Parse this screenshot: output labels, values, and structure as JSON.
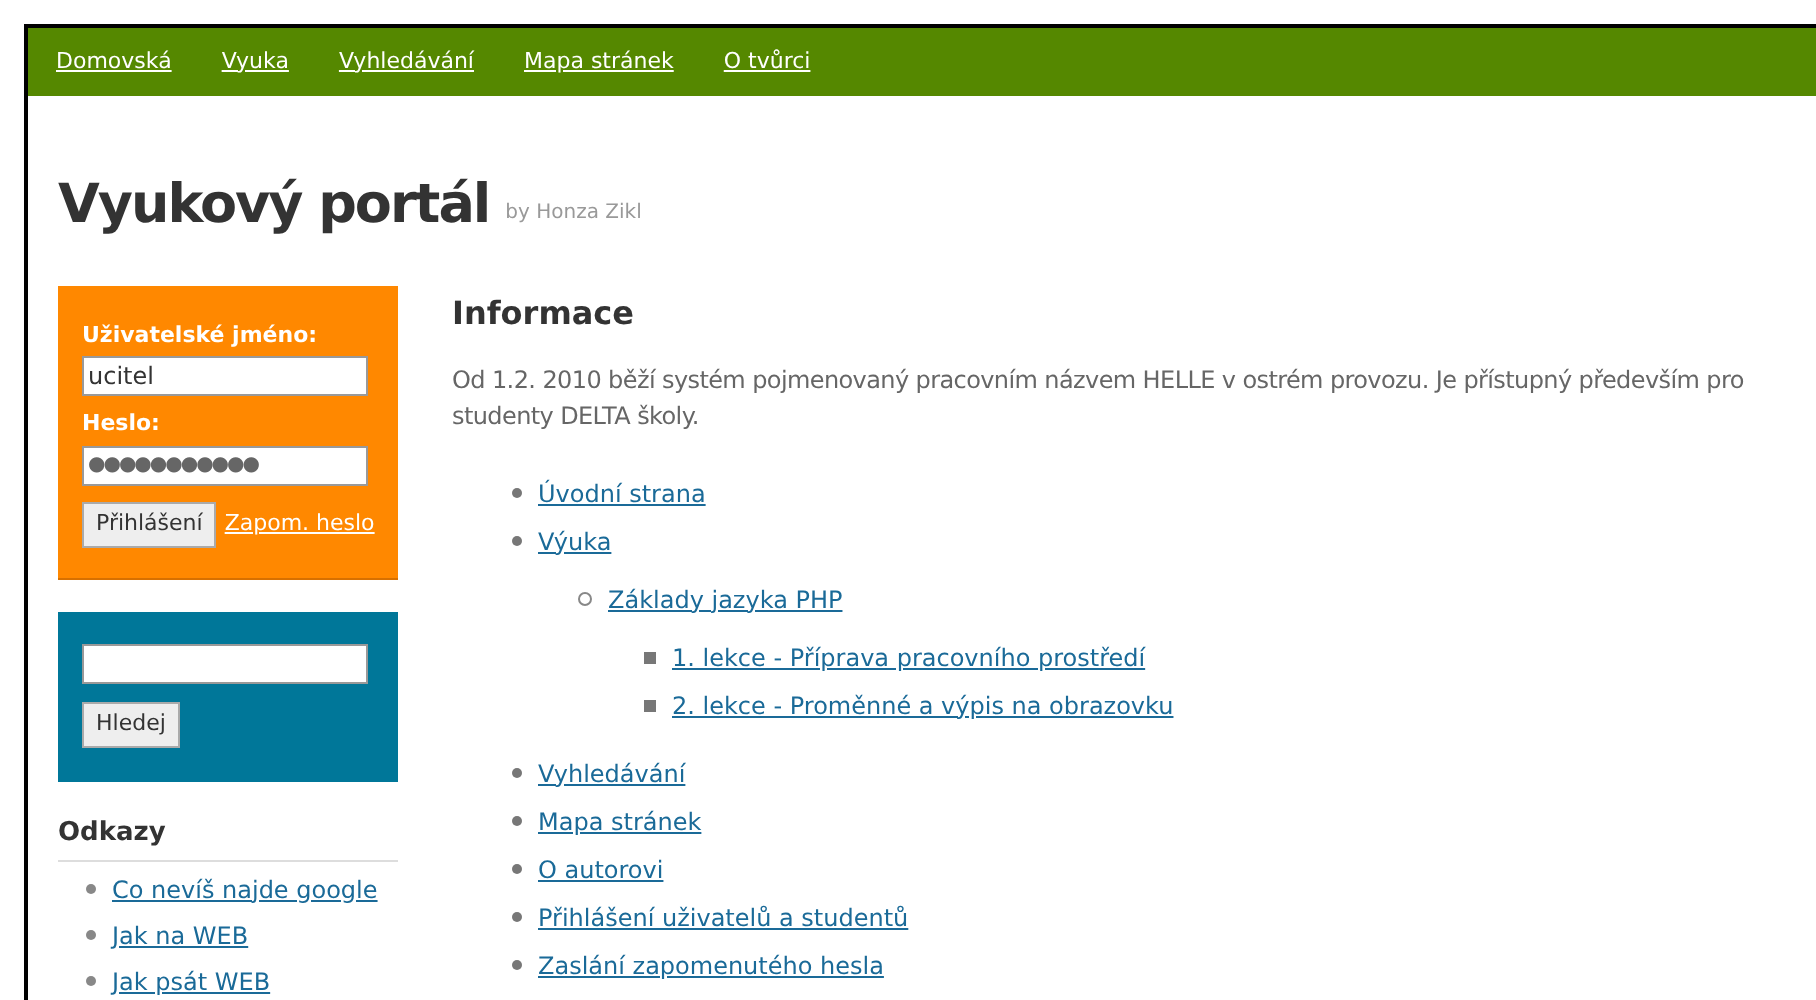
{
  "nav": [
    "Domovská",
    "Vyuka",
    "Vyhledávání",
    "Mapa stránek",
    "O tvůrci"
  ],
  "site_title": "Vyukový portál",
  "byline": "by Honza Zikl",
  "login": {
    "username_label": "Uživatelské jméno:",
    "username_value": "ucitel",
    "password_label": "Heslo:",
    "password_value": "●●●●●●●●●●●",
    "submit": "Přihlášení",
    "forgot_link": "Zapom. heslo"
  },
  "search": {
    "button": "Hledej"
  },
  "links": {
    "title": "Odkazy",
    "items": [
      "Co nevíš najde google",
      "Jak na WEB",
      "Jak psát WEB"
    ]
  },
  "content": {
    "heading": "Informace",
    "paragraph": "Od 1.2. 2010 běží systém pojmenovaný pracovním názvem HELLE v ostrém provozu. Je přístupný především pro studenty DELTA školy.",
    "menu": [
      {
        "label": "Úvodní strana"
      },
      {
        "label": "Výuka",
        "children": [
          {
            "label": "Základy jazyka PHP",
            "children": [
              {
                "label": "1. lekce - Příprava pracovního prostředí"
              },
              {
                "label": "2. lekce - Proměnné a výpis na obrazovku"
              }
            ]
          }
        ]
      },
      {
        "label": "Vyhledávání"
      },
      {
        "label": "Mapa stránek"
      },
      {
        "label": "O autorovi"
      },
      {
        "label": "Přihlášení uživatelů a studentů"
      },
      {
        "label": "Zaslání zapomenutého hesla"
      }
    ]
  }
}
